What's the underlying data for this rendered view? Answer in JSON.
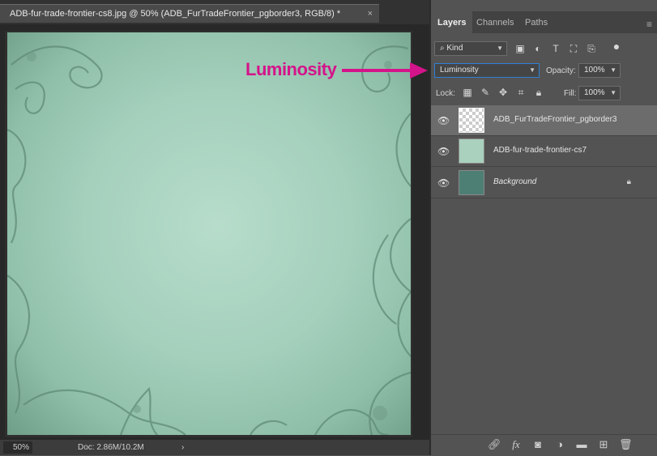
{
  "document": {
    "tab_title": "ADB-fur-trade-frontier-cs8.jpg @ 50% (ADB_FurTradeFrontier_pgborder3, RGB/8) *",
    "close_glyph": "×"
  },
  "status_bar": {
    "zoom": "50%",
    "doc_info": "Doc: 2.86M/10.2M",
    "chevron": "›"
  },
  "panel": {
    "tabs": [
      {
        "label": "Layers",
        "active": true
      },
      {
        "label": "Channels",
        "active": false
      },
      {
        "label": "Paths",
        "active": false
      }
    ],
    "filter": {
      "label": "Kind"
    },
    "blend_mode": "Luminosity",
    "opacity_label": "Opacity:",
    "opacity_value": "100%",
    "lock_label": "Lock:",
    "fill_label": "Fill:",
    "fill_value": "100%",
    "layers": [
      {
        "name": "ADB_FurTradeFrontier_pgborder3",
        "selected": true,
        "smart_object": true
      },
      {
        "name": "ADB-fur-trade-frontier-cs7",
        "selected": false,
        "smart_object": true
      },
      {
        "name": "Background",
        "selected": false,
        "locked": true
      }
    ]
  },
  "annotation": {
    "text": "Luminosity",
    "color": "#d4148a"
  }
}
